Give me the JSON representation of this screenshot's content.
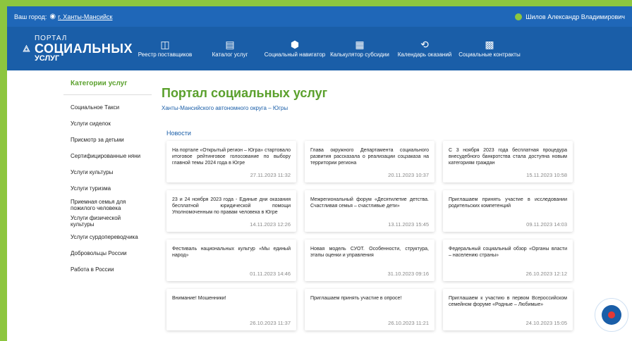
{
  "topbar": {
    "city_label": "Ваш город:",
    "city": "г. Ханты-Мансийск",
    "user": "Шилов Александр Владимирович"
  },
  "logo": {
    "line1": "ПОРТАЛ",
    "line2": "СОЦИАЛЬНЫХ",
    "line3": "УСЛУГ"
  },
  "nav": [
    {
      "label": "Реестр поставщиков",
      "icon": "registry-icon"
    },
    {
      "label": "Каталог услуг",
      "icon": "catalog-icon"
    },
    {
      "label": "Социальный навигатор",
      "icon": "navigator-icon"
    },
    {
      "label": "Калькулятор субсидии",
      "icon": "calculator-icon"
    },
    {
      "label": "Календарь оказаний",
      "icon": "calendar-icon"
    },
    {
      "label": "Социальные контракты",
      "icon": "contracts-icon"
    }
  ],
  "sidebar": {
    "title": "Категории услуг",
    "items": [
      "Социальное Такси",
      "Услуги сиделок",
      "Присмотр за детьми",
      "Сертифицированные няни",
      "Услуги культуры",
      "Услуги туризма",
      "Приемная семья для пожилого человека",
      "Услуги физической культуры",
      "Услуги сурдопереводчика",
      "Добровольцы России",
      "Работа в России"
    ]
  },
  "main": {
    "title": "Портал социальных услуг",
    "subtitle": "Ханты-Мансийского автономного округа – Югры",
    "news_title": "Новости"
  },
  "news": [
    {
      "text": "На портале «Открытый регион – Югра» стартовало итоговое рейтинговое голосование по выбору главной темы 2024 года в Югре",
      "date": "27.11.2023 11:32"
    },
    {
      "text": "Глава окружного Департамента социального развития рассказала о реализации соцзаказа на территории региона",
      "date": "20.11.2023 10:37"
    },
    {
      "text": "С 3 ноября 2023 года бесплатная процедура внесудебного банкротства стала доступна новым категориям граждан",
      "date": "15.11.2023 10:58"
    },
    {
      "text": "23 и 24 ноября 2023 года - Единые дни оказания бесплатной юридической помощи Уполномоченным по правам человека в Югре",
      "date": "14.11.2023 12:26"
    },
    {
      "text": "Межрегиональный форум «Десятилетие детства. Счастливая семья – счастливые дети»",
      "date": "13.11.2023 15:45"
    },
    {
      "text": "Приглашаем принять участие в исследовании родительских компетенций",
      "date": "09.11.2023 14:03"
    },
    {
      "text": "Фестиваль национальных культур «Мы единый народ»",
      "date": "01.11.2023 14:46"
    },
    {
      "text": "Новая модель СУОТ. Особенности, структура, этапы оценки и управления",
      "date": "31.10.2023 09:16"
    },
    {
      "text": "Федеральный социальный обзор «Органы власти – населению страны»",
      "date": "26.10.2023 12:12"
    },
    {
      "text": "Внимание! Мошенники!",
      "date": "26.10.2023 11:37"
    },
    {
      "text": "Приглашаем принять участие в опросе!",
      "date": "26.10.2023 11:21"
    },
    {
      "text": "Приглашаем к участию в первом Всероссийском семейном форуме «Родные – Любимые»",
      "date": "24.10.2023 15:05"
    }
  ]
}
